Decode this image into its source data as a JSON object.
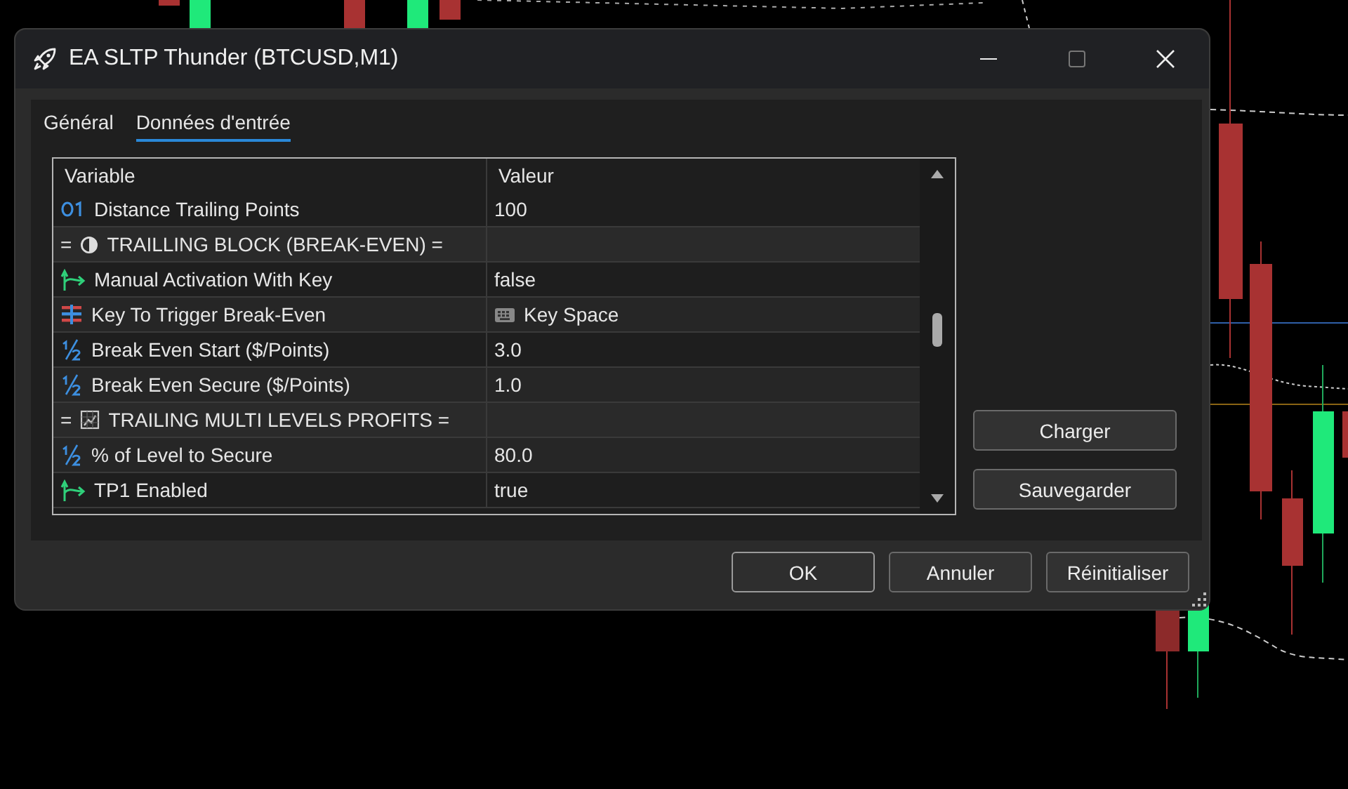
{
  "window": {
    "title": "EA SLTP Thunder (BTCUSD,M1)"
  },
  "tabs": [
    {
      "label": "Général",
      "selected": false
    },
    {
      "label": "Données d'entrée",
      "selected": true
    }
  ],
  "table": {
    "columns": [
      "Variable",
      "Valeur"
    ],
    "rows": [
      {
        "kind": "int",
        "name": "Distance Trailing Points",
        "value": "100"
      },
      {
        "kind": "section",
        "prefix": "=",
        "name": "TRAILLING BLOCK (BREAK-EVEN) ="
      },
      {
        "kind": "bool",
        "name": "Manual Activation With Key",
        "value": "false"
      },
      {
        "kind": "key",
        "name": "Key To Trigger Break-Even",
        "value": "Key Space"
      },
      {
        "kind": "double",
        "name": "Break Even Start ($/Points)",
        "value": "3.0"
      },
      {
        "kind": "double",
        "name": "Break Even Secure ($/Points)",
        "value": "1.0"
      },
      {
        "kind": "chartsection",
        "prefix": "=",
        "name": "TRAILING MULTI LEVELS PROFITS ="
      },
      {
        "kind": "double",
        "name": "% of Level to Secure",
        "value": "80.0"
      },
      {
        "kind": "bool",
        "name": "TP1 Enabled",
        "value": "true"
      }
    ]
  },
  "side_buttons": [
    "Charger",
    "Sauvegarder"
  ],
  "buttons": [
    "OK",
    "Annuler",
    "Réinitialiser"
  ]
}
